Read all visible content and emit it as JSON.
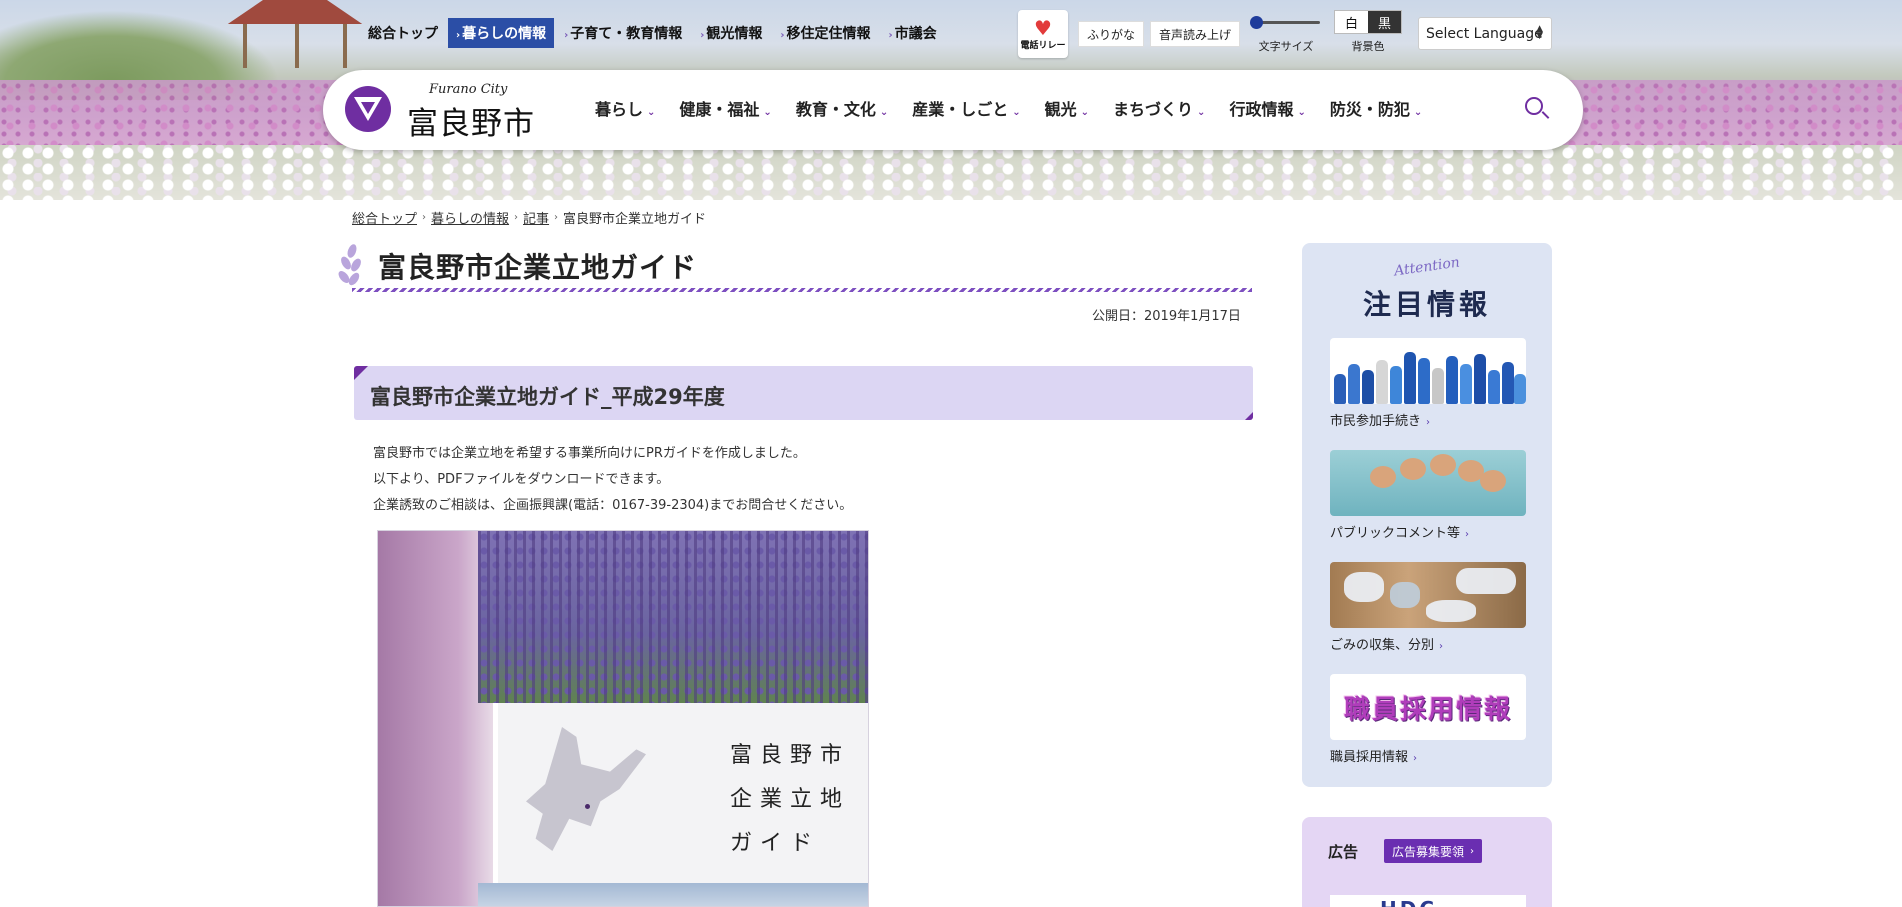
{
  "top_nav": [
    {
      "label": "総合トップ",
      "active": false
    },
    {
      "label": "暮らしの情報",
      "active": true
    },
    {
      "label": "子育て・教育情報",
      "active": false
    },
    {
      "label": "観光情報",
      "active": false
    },
    {
      "label": "移住定住情報",
      "active": false
    },
    {
      "label": "市議会",
      "active": false
    }
  ],
  "utility": {
    "relay_label": "電話リレー",
    "furigana": "ふりがな",
    "read_aloud": "音声読み上げ",
    "font_size_label": "文字サイズ",
    "bg_white": "白",
    "bg_black": "黒",
    "bg_color_label": "背景色",
    "language_select": "Select Language"
  },
  "logo": {
    "en": "Furano City",
    "jp": "富良野市"
  },
  "global_nav": [
    "暮らし",
    "健康・福祉",
    "教育・文化",
    "産業・しごと",
    "観光",
    "まちづくり",
    "行政情報",
    "防災・防犯"
  ],
  "breadcrumb": [
    "総合トップ",
    "暮らしの情報",
    "記事",
    "富良野市企業立地ガイド"
  ],
  "article": {
    "title": "富良野市企業立地ガイド",
    "published": "公開日：2019年1月17日",
    "section_heading": "富良野市企業立地ガイド_平成29年度",
    "paragraphs": [
      "富良野市では企業立地を希望する事業所向けにPRガイドを作成しました。",
      "以下より、PDFファイルをダウンロードできます。",
      "企業誘致のご相談は、企画振興課(電話：0167-39-2304)までお問合せください。"
    ],
    "cover_lines": [
      "富良野市",
      "企業立地",
      "ガイド"
    ]
  },
  "sidebar": {
    "attention_en": "Attention",
    "attention_title": "注目情報",
    "cards": [
      {
        "label": "市民参加手続き"
      },
      {
        "label": "パブリックコメント等"
      },
      {
        "label": "ごみの収集、分別"
      },
      {
        "label": "職員採用情報",
        "banner_text": "職員採用情報"
      }
    ],
    "ad_label": "広告",
    "ad_button": "広告募集要領"
  },
  "colors": {
    "accent": "#6f2ea1",
    "active_nav": "#2b4ea6",
    "section_bg": "#dcd6f3",
    "sidebar_bg": "#dde4f3"
  }
}
